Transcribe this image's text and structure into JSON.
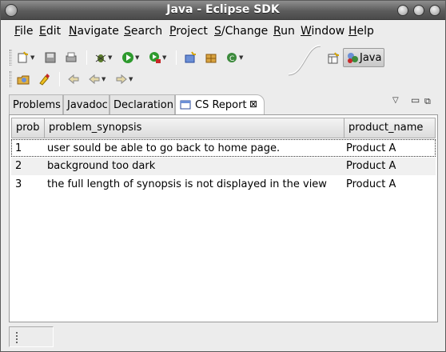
{
  "window": {
    "title": "Java - Eclipse SDK"
  },
  "menu": [
    {
      "m": "F",
      "rest": "ile"
    },
    {
      "m": "E",
      "rest": "dit"
    },
    {
      "m": "N",
      "rest": "avigate"
    },
    {
      "m": "S",
      "rest": "earch"
    },
    {
      "m": "P",
      "rest": "roject"
    },
    {
      "m": "S",
      "rest": "/Change"
    },
    {
      "m": "R",
      "rest": "un"
    },
    {
      "m": "W",
      "rest": "indow"
    },
    {
      "m": "H",
      "rest": "elp"
    }
  ],
  "perspective": {
    "label": "Java"
  },
  "tabs": [
    "Problems",
    "Javadoc",
    "Declaration",
    "CS Report"
  ],
  "active_tab": "CS Report",
  "table": {
    "columns": [
      "prob",
      "problem_synopsis",
      "product_name"
    ],
    "rows": [
      {
        "prob": "1",
        "synopsis": "user sould be able to go back to home page.",
        "product": "Product A"
      },
      {
        "prob": "2",
        "synopsis": "background too dark",
        "product": "Product A"
      },
      {
        "prob": "3",
        "synopsis": "the full length of synopsis is not displayed in the view",
        "product": "Product A"
      }
    ]
  },
  "colors": {
    "titlebar": "#5c5c5c",
    "selected_row_border": "#333333",
    "alt_row": "#f0f0f0"
  }
}
